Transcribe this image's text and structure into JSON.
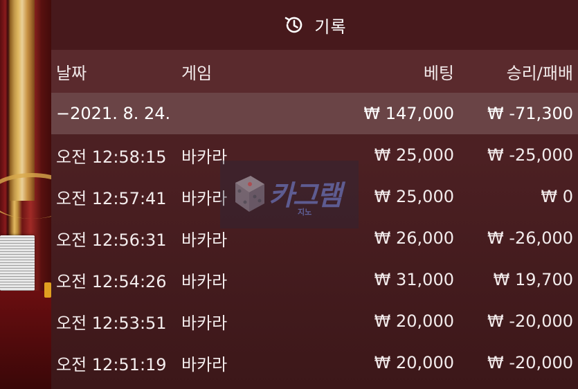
{
  "header": {
    "title": "기록",
    "icon": "history-icon"
  },
  "columns": {
    "date": "날짜",
    "game": "게임",
    "bet": "베팅",
    "win_loss": "승리/패배"
  },
  "summary": {
    "date": "−2021. 8. 24.",
    "bet": "₩ 147,000",
    "win_loss": "₩ -71,300"
  },
  "rows": [
    {
      "time": "오전 12:58:15",
      "game": "바카라",
      "bet": "₩ 25,000",
      "win_loss": "₩ -25,000"
    },
    {
      "time": "오전 12:57:41",
      "game": "바카라",
      "bet": "₩ 25,000",
      "win_loss": "₩ 0"
    },
    {
      "time": "오전 12:56:31",
      "game": "바카라",
      "bet": "₩ 26,000",
      "win_loss": "₩ -26,000"
    },
    {
      "time": "오전 12:54:26",
      "game": "바카라",
      "bet": "₩ 31,000",
      "win_loss": "₩ 19,700"
    },
    {
      "time": "오전 12:53:51",
      "game": "바카라",
      "bet": "₩ 20,000",
      "win_loss": "₩ -20,000"
    },
    {
      "time": "오전 12:51:19",
      "game": "바카라",
      "bet": "₩ 20,000",
      "win_loss": "₩ -20,000"
    }
  ],
  "watermark": {
    "text": "카그램",
    "sub": "지노"
  }
}
